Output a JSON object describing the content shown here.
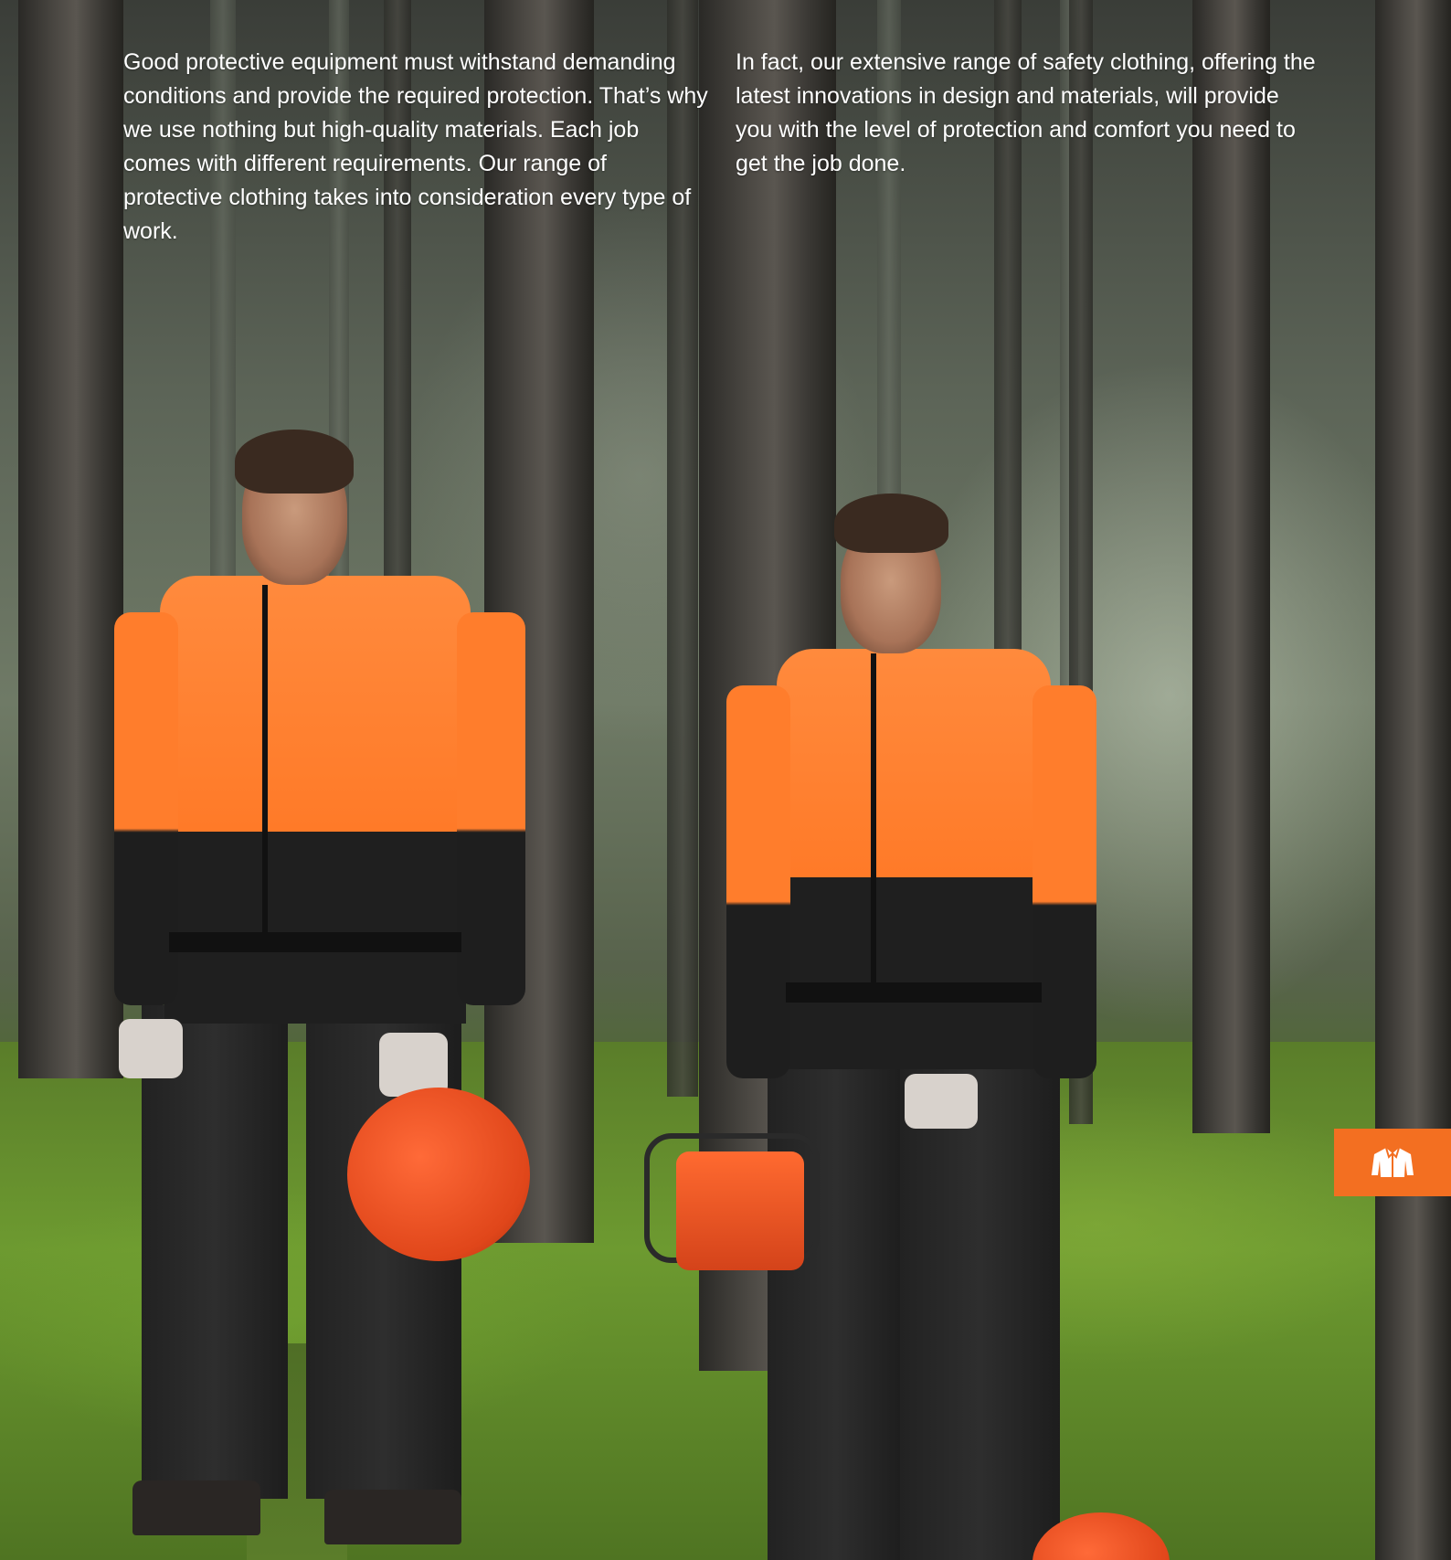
{
  "paragraphs": {
    "left": "Good protective equipment must withstand demanding conditions and provide the required protection. That’s why we use nothing but high-quality materials. Each job comes with different requirements. Our range of protective clothing takes into consideration every type of work.",
    "right": "In fact, our extensive range of safety clothing, offering the latest innovations in design and materials, will provide you with the level of protection and comfort you need to get the job done."
  },
  "photo": {
    "subject": "two-forestry-workers-in-protective-clothing"
  },
  "section_tab": {
    "icon": "jacket-icon",
    "color": "#f36f21"
  }
}
